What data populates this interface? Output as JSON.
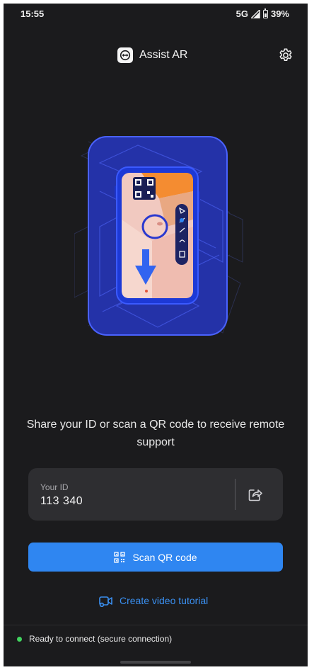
{
  "status_bar": {
    "time": "15:55",
    "network": "5G",
    "battery": "39%"
  },
  "header": {
    "app_title": "Assist AR",
    "icons": {
      "logo": "teamviewer-logo-icon",
      "settings": "gear-icon"
    }
  },
  "illustration": {
    "subject": "phone with QR code, circle annotation, arrow and toolbar",
    "icon": "ar-phone-illustration"
  },
  "instruction": "Share your ID or scan a QR code to receive remote support",
  "id_card": {
    "label": "Your ID",
    "value": "113 340",
    "share_icon": "share-icon"
  },
  "scan_button": {
    "label": "Scan QR code",
    "icon": "qr-code-icon"
  },
  "video_tutorial": {
    "label": "Create video tutorial",
    "icon": "video-camera-icon"
  },
  "footer": {
    "status": "Ready to connect (secure connection)"
  },
  "colors": {
    "background": "#1b1b1d",
    "card": "#2e2e31",
    "accent": "#2f86f1",
    "link": "#3a8ff0",
    "status_ok": "#41d45f"
  }
}
